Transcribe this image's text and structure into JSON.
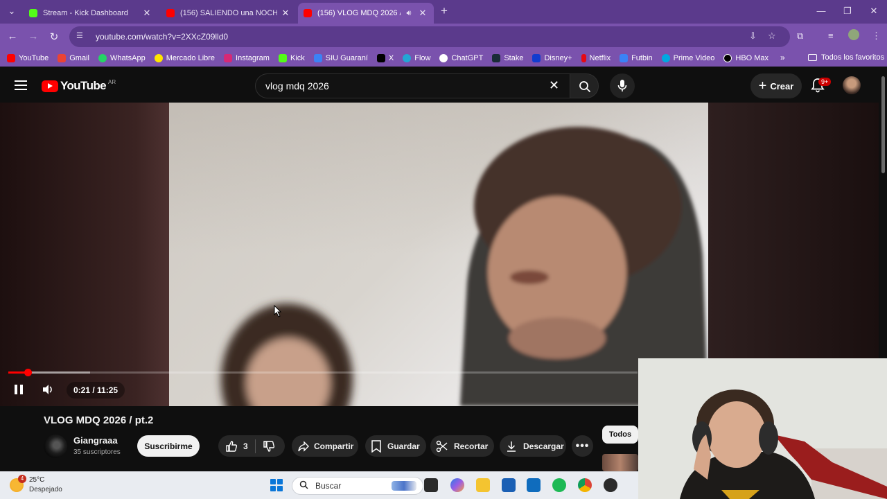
{
  "browser": {
    "tabs": [
      {
        "title": "Stream - Kick Dashboard",
        "favicon_color": "#53fc18",
        "active": false
      },
      {
        "title": "(156) SALIENDO una NOCHE de",
        "favicon_color": "#ff0000",
        "active": false
      },
      {
        "title": "(156) VLOG MDQ 2026 / pt.",
        "favicon_color": "#ff0000",
        "active": true
      }
    ],
    "url": "youtube.com/watch?v=2XXcZ09lld0",
    "bookmarks": [
      {
        "label": "YouTube",
        "color": "#ff0000"
      },
      {
        "label": "Gmail",
        "color": "#ea4335"
      },
      {
        "label": "WhatsApp",
        "color": "#25d366"
      },
      {
        "label": "Mercado Libre",
        "color": "#ffe600"
      },
      {
        "label": "Instagram",
        "color": "#d62976"
      },
      {
        "label": "Kick",
        "color": "#53fc18"
      },
      {
        "label": "SIU Guaraní",
        "color": "#3b82f6"
      },
      {
        "label": "X",
        "color": "#000000"
      },
      {
        "label": "Flow",
        "color": "#23a6d5"
      },
      {
        "label": "ChatGPT",
        "color": "#ffffff"
      },
      {
        "label": "Stake",
        "color": "#1a2c38"
      },
      {
        "label": "Disney+",
        "color": "#113ccf"
      },
      {
        "label": "Netflix",
        "color": "#e50914"
      },
      {
        "label": "Futbin",
        "color": "#3b82f6"
      },
      {
        "label": "Prime Video",
        "color": "#00a8e1"
      },
      {
        "label": "HBO Max",
        "color": "#000000"
      }
    ],
    "bookmarks_more": "»",
    "all_bookmarks": "Todos los favoritos"
  },
  "youtube": {
    "logo_text": "YouTube",
    "country_code": "AR",
    "search_query": "vlog mdq 2026",
    "create_label": "Crear",
    "notifications_badge": "9+",
    "player": {
      "current_time": "0:21",
      "duration": "11:25",
      "time_display": "0:21 / 11:25",
      "progress_fraction": 0.031,
      "buffered_fraction": 0.13
    },
    "video_title": "VLOG MDQ 2026 / pt.2",
    "channel_name": "Giangraaa",
    "subscribers": "35 suscriptores",
    "subscribe_label": "Suscribirme",
    "like_count": "3",
    "share_label": "Compartir",
    "save_label": "Guardar",
    "clip_label": "Recortar",
    "download_label": "Descargar",
    "chip_all": "Todos"
  },
  "taskbar": {
    "weather_temp": "25°C",
    "weather_desc": "Despejado",
    "weather_badge": "4",
    "search_placeholder": "Buscar"
  },
  "colors": {
    "tab_strip": "#5b3a8c",
    "toolbar": "#7a52ad",
    "yt_background": "#0f0f0f",
    "yt_red": "#ff0000"
  }
}
